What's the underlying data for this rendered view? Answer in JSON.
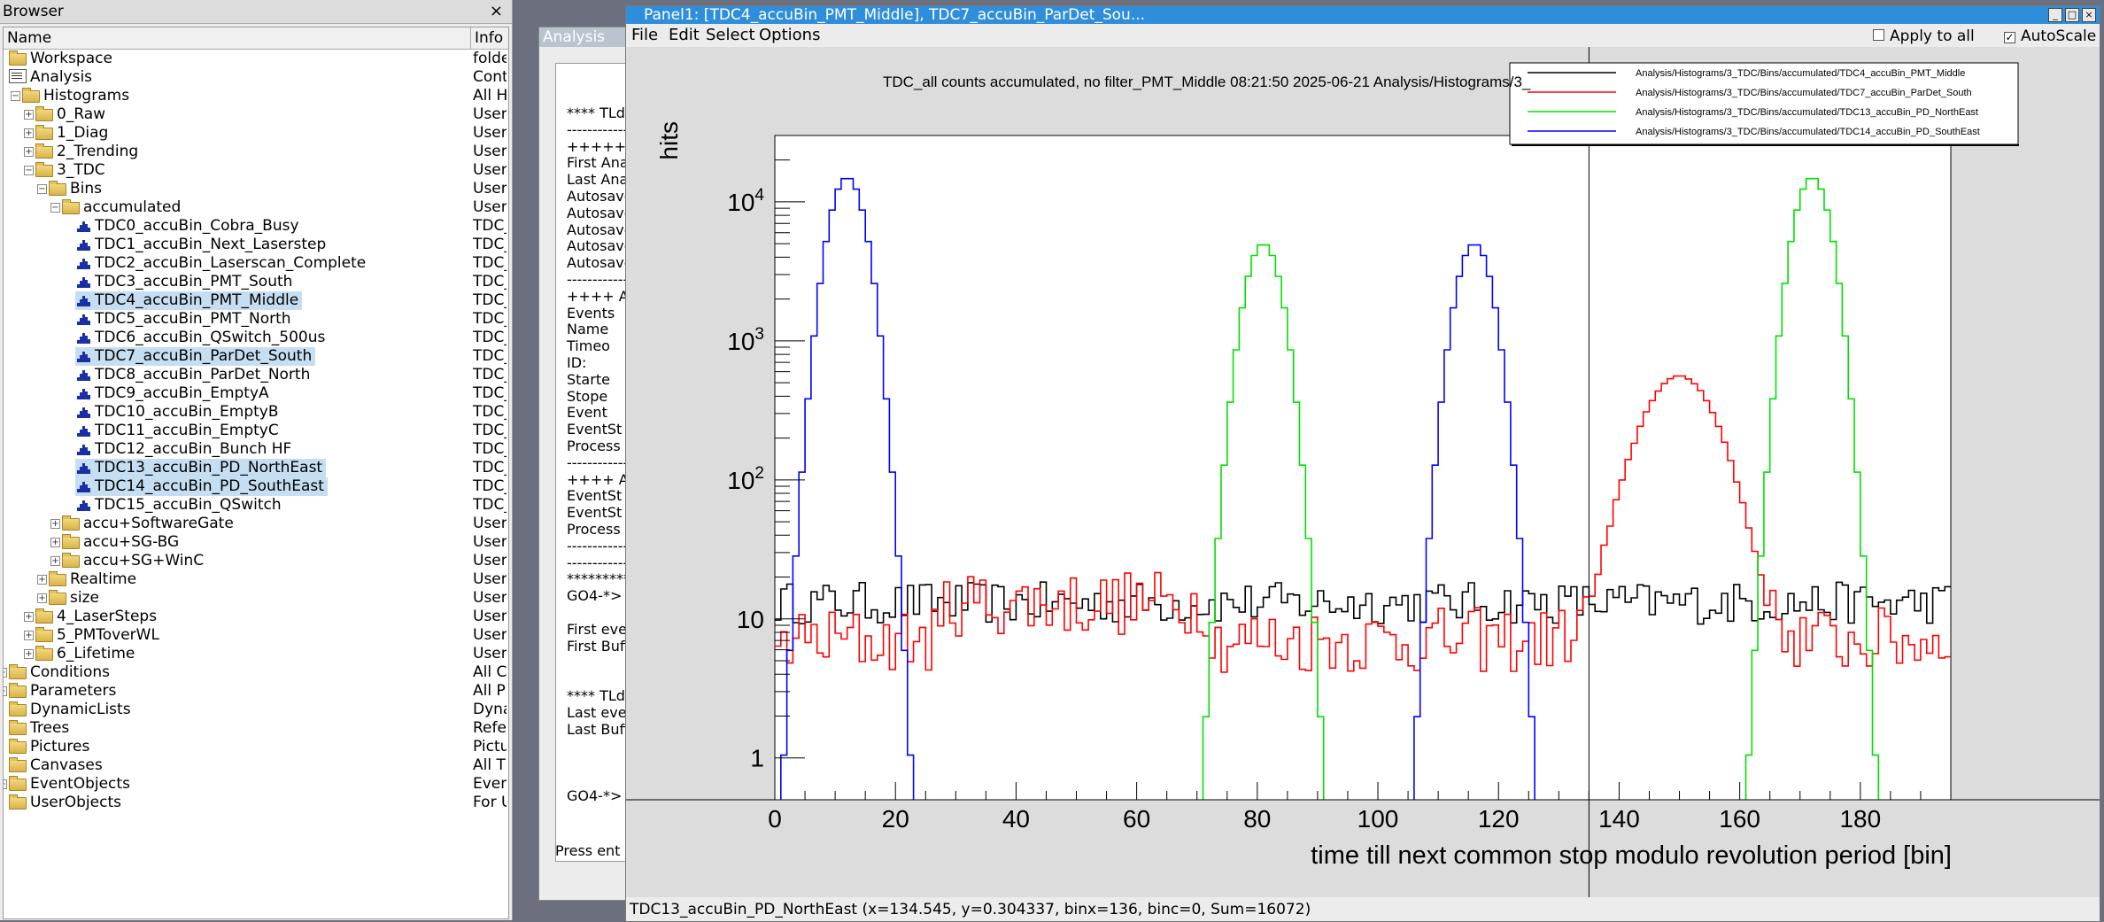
{
  "browser": {
    "title": "Browser",
    "close_glyph": "×",
    "col_name": "Name",
    "col_info": "Info",
    "rows": [
      {
        "label": "Workspace",
        "info": "folde",
        "indent": 0,
        "icon": "folder-icon",
        "expander": "none"
      },
      {
        "label": "Analysis",
        "info": "Cont",
        "indent": 0,
        "icon": "analysis-icon",
        "expander": "none"
      },
      {
        "label": "Histograms",
        "info": "All H",
        "indent": 1,
        "icon": "folder-icon",
        "expander": "minus"
      },
      {
        "label": "0_Raw",
        "info": "User",
        "indent": 2,
        "icon": "folder-icon",
        "expander": "plus"
      },
      {
        "label": "1_Diag",
        "info": "User",
        "indent": 2,
        "icon": "folder-icon",
        "expander": "plus"
      },
      {
        "label": "2_Trending",
        "info": "User",
        "indent": 2,
        "icon": "folder-icon",
        "expander": "plus"
      },
      {
        "label": "3_TDC",
        "info": "User",
        "indent": 2,
        "icon": "folder-icon",
        "expander": "minus"
      },
      {
        "label": "Bins",
        "info": "User",
        "indent": 3,
        "icon": "folder-icon",
        "expander": "minus"
      },
      {
        "label": "accumulated",
        "info": "User",
        "indent": 4,
        "icon": "folder-icon",
        "expander": "minus"
      },
      {
        "label": "TDC0_accuBin_Cobra_Busy",
        "info": "TDC_",
        "indent": 5,
        "icon": "hist-icon",
        "expander": "none"
      },
      {
        "label": "TDC1_accuBin_Next_Laserstep",
        "info": "TDC_",
        "indent": 5,
        "icon": "hist-icon",
        "expander": "none"
      },
      {
        "label": "TDC2_accuBin_Laserscan_Complete",
        "info": "TDC_",
        "indent": 5,
        "icon": "hist-icon",
        "expander": "none"
      },
      {
        "label": "TDC3_accuBin_PMT_South",
        "info": "TDC_",
        "indent": 5,
        "icon": "hist-icon",
        "expander": "none"
      },
      {
        "label": "TDC4_accuBin_PMT_Middle",
        "info": "TDC_",
        "indent": 5,
        "icon": "hist-icon",
        "expander": "none",
        "selected": true
      },
      {
        "label": "TDC5_accuBin_PMT_North",
        "info": "TDC_",
        "indent": 5,
        "icon": "hist-icon",
        "expander": "none"
      },
      {
        "label": "TDC6_accuBin_QSwitch_500us",
        "info": "TDC_",
        "indent": 5,
        "icon": "hist-icon",
        "expander": "none"
      },
      {
        "label": "TDC7_accuBin_ParDet_South",
        "info": "TDC_",
        "indent": 5,
        "icon": "hist-icon",
        "expander": "none",
        "selected": true
      },
      {
        "label": "TDC8_accuBin_ParDet_North",
        "info": "TDC_",
        "indent": 5,
        "icon": "hist-icon",
        "expander": "none"
      },
      {
        "label": "TDC9_accuBin_EmptyA",
        "info": "TDC_",
        "indent": 5,
        "icon": "hist-icon",
        "expander": "none"
      },
      {
        "label": "TDC10_accuBin_EmptyB",
        "info": "TDC_",
        "indent": 5,
        "icon": "hist-icon",
        "expander": "none"
      },
      {
        "label": "TDC11_accuBin_EmptyC",
        "info": "TDC_",
        "indent": 5,
        "icon": "hist-icon",
        "expander": "none"
      },
      {
        "label": "TDC12_accuBin_Bunch HF",
        "info": "TDC_",
        "indent": 5,
        "icon": "hist-icon",
        "expander": "none"
      },
      {
        "label": "TDC13_accuBin_PD_NorthEast",
        "info": "TDC_",
        "indent": 5,
        "icon": "hist-icon",
        "expander": "none",
        "selected": true
      },
      {
        "label": "TDC14_accuBin_PD_SouthEast",
        "info": "TDC_",
        "indent": 5,
        "icon": "hist-icon",
        "expander": "none",
        "selected": true
      },
      {
        "label": "TDC15_accuBin_QSwitch",
        "info": "TDC_",
        "indent": 5,
        "icon": "hist-icon",
        "expander": "none"
      },
      {
        "label": "accu+SoftwareGate",
        "info": "User",
        "indent": 4,
        "icon": "folder-icon",
        "expander": "plus"
      },
      {
        "label": "accu+SG-BG",
        "info": "User",
        "indent": 4,
        "icon": "folder-icon",
        "expander": "plus"
      },
      {
        "label": "accu+SG+WinC",
        "info": "User",
        "indent": 4,
        "icon": "folder-icon",
        "expander": "plus"
      },
      {
        "label": "Realtime",
        "info": "User",
        "indent": 3,
        "icon": "folder-icon",
        "expander": "plus"
      },
      {
        "label": "size",
        "info": "User",
        "indent": 3,
        "icon": "folder-icon",
        "expander": "plus"
      },
      {
        "label": "4_LaserSteps",
        "info": "User",
        "indent": 2,
        "icon": "folder-icon",
        "expander": "plus"
      },
      {
        "label": "5_PMToverWL",
        "info": "User",
        "indent": 2,
        "icon": "folder-icon",
        "expander": "plus"
      },
      {
        "label": "6_Lifetime",
        "info": "User",
        "indent": 2,
        "icon": "folder-icon",
        "expander": "plus"
      },
      {
        "label": "Conditions",
        "info": "All C",
        "indent": 0,
        "icon": "folder-icon",
        "expander": "plus"
      },
      {
        "label": "Parameters",
        "info": "All P",
        "indent": 0,
        "icon": "folder-icon",
        "expander": "plus"
      },
      {
        "label": "DynamicLists",
        "info": "Dyna",
        "indent": 0,
        "icon": "folder-icon",
        "expander": "none"
      },
      {
        "label": "Trees",
        "info": "Refe",
        "indent": 0,
        "icon": "folder-icon",
        "expander": "none"
      },
      {
        "label": "Pictures",
        "info": "Pictu",
        "indent": 0,
        "icon": "folder-icon",
        "expander": "none"
      },
      {
        "label": "Canvases",
        "info": "All T",
        "indent": 0,
        "icon": "folder-icon",
        "expander": "none"
      },
      {
        "label": "EventObjects",
        "info": "Even",
        "indent": 0,
        "icon": "folder-icon",
        "expander": "plus"
      },
      {
        "label": "UserObjects",
        "info": "For U",
        "indent": 0,
        "icon": "folder-icon",
        "expander": "none"
      }
    ]
  },
  "analysis_window": {
    "title": "Analysis",
    "lines": [
      "**** TLda",
      "------------",
      "+++++ +",
      "First Ana",
      "Last Ana",
      "Autosave",
      "Autosave",
      "Autosave",
      "Autosave",
      "Autosave",
      "------------",
      "++++ A",
      "Events",
      "Name",
      "Timeo",
      "ID:",
      "Starte",
      "Stope",
      "Event",
      "EventSt",
      "Process",
      "------------",
      "++++ A",
      "EventSt",
      "EventSt",
      "Process",
      "------------",
      "------------",
      "*********",
      "GO4-*> ",
      "",
      "First eve",
      "First Buff",
      "",
      "",
      "**** TLda",
      "Last eve",
      "Last Buff",
      "",
      "",
      "",
      "GO4-*> "
    ],
    "prompt": "Press ent"
  },
  "panel": {
    "title": "Panel1: [TDC4_accuBin_PMT_Middle], TDC7_accuBin_ParDet_Sou...",
    "menus": [
      "File",
      "Edit",
      "Select",
      "Options"
    ],
    "apply_to_all_label": "Apply to all",
    "apply_to_all_checked": false,
    "autoscale_label": "AutoScale",
    "autoscale_checked": true,
    "status": "TDC13_accuBin_PD_NorthEast  (x=134.545, y=0.304337, binx=136, binc=0, Sum=16072)",
    "ctrl_glyphs": [
      "_",
      "□",
      "×"
    ]
  },
  "chart_data": {
    "type": "line",
    "title": "TDC_all counts accumulated, no filter_PMT_Middle  08:21:50  2025-06-21  Analysis/Histograms/3_",
    "xlabel": "time till next common stop modulo revolution period [bin]",
    "ylabel": "hits",
    "xlim": [
      0,
      195
    ],
    "ylim": [
      0.5,
      30000
    ],
    "log_y": true,
    "x_ticks": [
      "0",
      "20",
      "40",
      "60",
      "80",
      "100",
      "120",
      "140",
      "160",
      "180"
    ],
    "y_ticks": [
      {
        "value": 1,
        "label": "1"
      },
      {
        "value": 10,
        "label": "10"
      },
      {
        "value": 100,
        "label": "10",
        "exp": "2"
      },
      {
        "value": 1000,
        "label": "10",
        "exp": "3"
      },
      {
        "value": 10000,
        "label": "10",
        "exp": "4"
      }
    ],
    "crosshair_x": 135,
    "legend_position": "top-right",
    "series": [
      {
        "name": "Analysis/Histograms/3_TDC/Bins/accumulated/TDC4_accuBin_PMT_Middle",
        "color": "#000000",
        "kind": "flat",
        "base": 13,
        "jitter": 0.35,
        "peaks": []
      },
      {
        "name": "Analysis/Histograms/3_TDC/Bins/accumulated/TDC7_accuBin_ParDet_South",
        "color": "#ff0000",
        "kind": "flat",
        "base": 7,
        "jitter": 0.55,
        "peaks": [
          {
            "center": 150,
            "height": 550,
            "sigma": 5
          }
        ],
        "low_segments": [
          [
            28,
            72,
            13
          ]
        ]
      },
      {
        "name": "Analysis/Histograms/3_TDC/Bins/accumulated/TDC13_accuBin_PD_NorthEast",
        "color": "#00e000",
        "kind": "peaks",
        "peaks": [
          {
            "center": 81,
            "height": 5000,
            "sigma": 2.4
          },
          {
            "center": 172,
            "height": 15000,
            "sigma": 2.4
          }
        ]
      },
      {
        "name": "Analysis/Histograms/3_TDC/Bins/accumulated/TDC14_accuBin_PD_SouthEast",
        "color": "#0000ff",
        "kind": "peaks",
        "peaks": [
          {
            "center": 12,
            "height": 15000,
            "sigma": 2.4
          },
          {
            "center": 116,
            "height": 5000,
            "sigma": 2.4
          }
        ]
      }
    ]
  }
}
